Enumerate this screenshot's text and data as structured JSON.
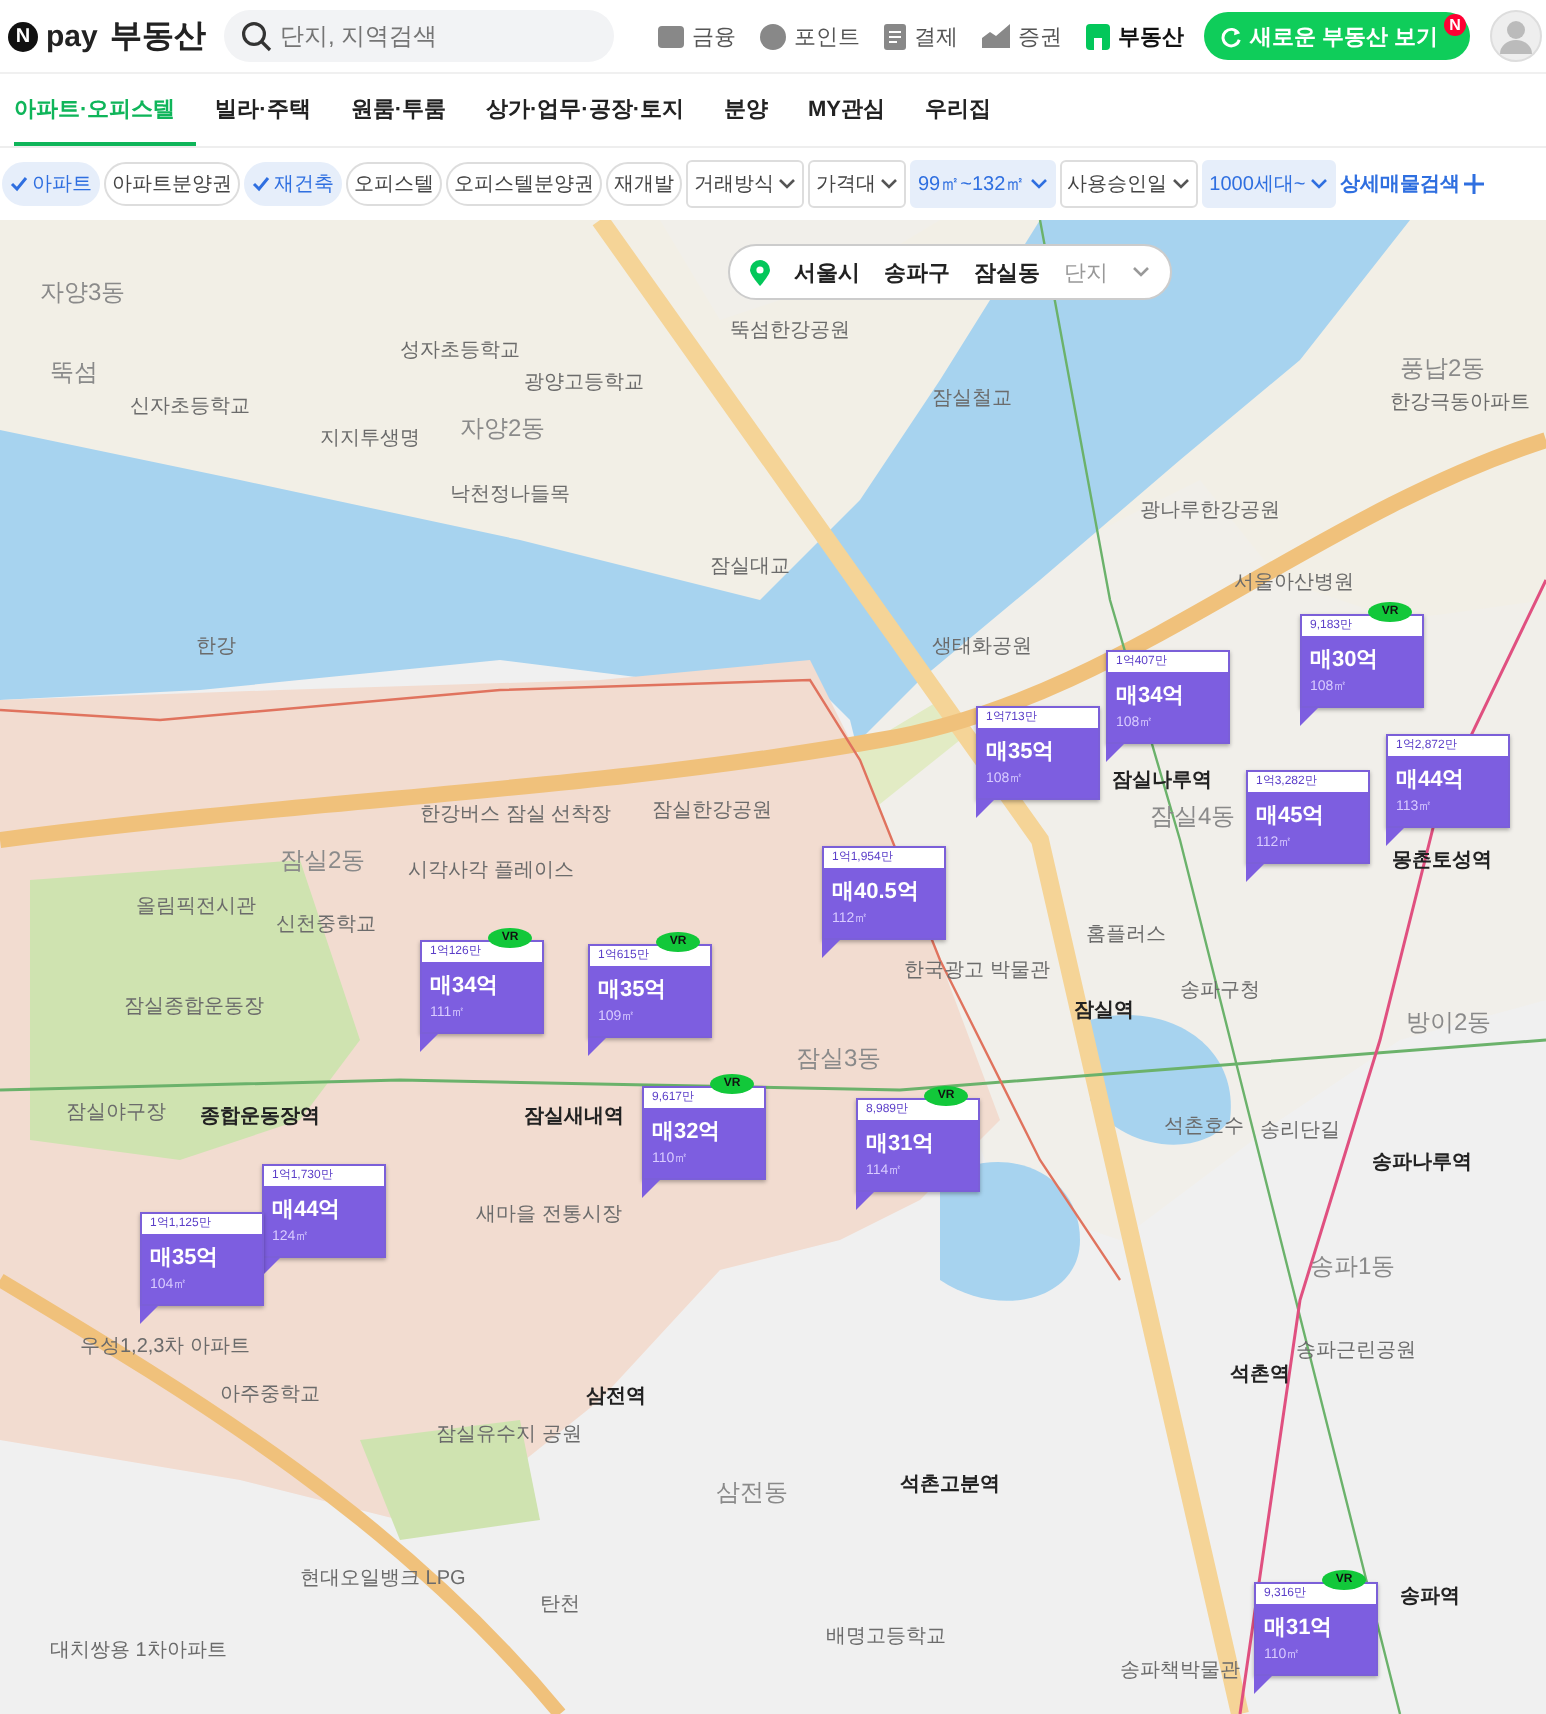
{
  "header": {
    "logo_mark": "N",
    "logo_text": "pay",
    "service": "부동산",
    "search": {
      "placeholder": "단지, 지역검색"
    },
    "nav": [
      {
        "label": "금융",
        "selected": false
      },
      {
        "label": "포인트",
        "selected": false
      },
      {
        "label": "결제",
        "selected": false
      },
      {
        "label": "증권",
        "selected": false
      },
      {
        "label": "부동산",
        "selected": true
      }
    ],
    "cta": {
      "label": "새로운 부동산 보기",
      "badge": "N"
    }
  },
  "tabs": [
    {
      "label": "아파트·오피스텔",
      "selected": true
    },
    {
      "label": "빌라·주택",
      "selected": false
    },
    {
      "label": "원룸·투룸",
      "selected": false
    },
    {
      "label": "상가·업무·공장·토지",
      "selected": false
    },
    {
      "label": "분양",
      "selected": false
    },
    {
      "label": "MY관심",
      "selected": false
    },
    {
      "label": "우리집",
      "selected": false
    }
  ],
  "filters": [
    {
      "kind": "chip",
      "label": "아파트",
      "checked": true
    },
    {
      "kind": "chip",
      "label": "아파트분양권",
      "checked": false
    },
    {
      "kind": "chip",
      "label": "재건축",
      "checked": true
    },
    {
      "kind": "chip",
      "label": "오피스텔",
      "checked": false
    },
    {
      "kind": "chip",
      "label": "오피스텔분양권",
      "checked": false
    },
    {
      "kind": "chip",
      "label": "재개발",
      "checked": false
    },
    {
      "kind": "dropdown",
      "label": "거래방식",
      "checked": false
    },
    {
      "kind": "dropdown",
      "label": "가격대",
      "checked": false
    },
    {
      "kind": "dropdown",
      "label": "99㎡~132㎡",
      "checked": true
    },
    {
      "kind": "dropdown",
      "label": "사용승인일",
      "checked": false
    },
    {
      "kind": "dropdown",
      "label": "1000세대~",
      "checked": true
    },
    {
      "kind": "link",
      "label": "상세매물검색"
    }
  ],
  "breadcrumb": {
    "items": [
      "서울시",
      "송파구",
      "잠실동"
    ],
    "placeholder": "단지"
  },
  "map": {
    "labels": [
      {
        "text": "자양3동",
        "kind": "district"
      },
      {
        "text": "뚝섬",
        "kind": "district"
      },
      {
        "text": "신자초등학교",
        "kind": "place"
      },
      {
        "text": "성자초등학교",
        "kind": "place"
      },
      {
        "text": "지지투생명",
        "kind": "place"
      },
      {
        "text": "자양2동",
        "kind": "district"
      },
      {
        "text": "광양고등학교",
        "kind": "place"
      },
      {
        "text": "뚝섬한강공원",
        "kind": "place"
      },
      {
        "text": "낙천정나들목",
        "kind": "place"
      },
      {
        "text": "잠실철교",
        "kind": "place"
      },
      {
        "text": "한강",
        "kind": "place"
      },
      {
        "text": "잠실대교",
        "kind": "place"
      },
      {
        "text": "광나루한강공원",
        "kind": "place"
      },
      {
        "text": "서울아산병원",
        "kind": "place"
      },
      {
        "text": "풍납2동",
        "kind": "district"
      },
      {
        "text": "한강극동아파트",
        "kind": "place"
      },
      {
        "text": "생태화공원",
        "kind": "place"
      },
      {
        "text": "한강버스 잠실 선착장",
        "kind": "place"
      },
      {
        "text": "잠실한강공원",
        "kind": "place"
      },
      {
        "text": "잠실2동",
        "kind": "district"
      },
      {
        "text": "시각사각 플레이스",
        "kind": "place"
      },
      {
        "text": "올림픽전시관",
        "kind": "place"
      },
      {
        "text": "신천중학교",
        "kind": "place"
      },
      {
        "text": "잠실종합운동장",
        "kind": "place"
      },
      {
        "text": "잠실야구장",
        "kind": "place"
      },
      {
        "text": "종합운동장역",
        "kind": "station"
      },
      {
        "text": "잠실새내역",
        "kind": "station"
      },
      {
        "text": "새마을 전통시장",
        "kind": "place"
      },
      {
        "text": "잠실3동",
        "kind": "district"
      },
      {
        "text": "한국광고 박물관",
        "kind": "place"
      },
      {
        "text": "홈플러스",
        "kind": "place"
      },
      {
        "text": "잠실역",
        "kind": "station"
      },
      {
        "text": "송파구청",
        "kind": "place"
      },
      {
        "text": "석촌호수",
        "kind": "place"
      },
      {
        "text": "방이2동",
        "kind": "district"
      },
      {
        "text": "송파나루역",
        "kind": "station"
      },
      {
        "text": "송리단길",
        "kind": "place"
      },
      {
        "text": "송파1동",
        "kind": "district"
      },
      {
        "text": "석촌역",
        "kind": "station"
      },
      {
        "text": "삼전역",
        "kind": "station"
      },
      {
        "text": "석촌고분역",
        "kind": "station"
      },
      {
        "text": "삼전동",
        "kind": "district"
      },
      {
        "text": "송파책박물관",
        "kind": "place"
      },
      {
        "text": "송파역",
        "kind": "station"
      },
      {
        "text": "탄천",
        "kind": "place"
      },
      {
        "text": "현대오일뱅크 LPG",
        "kind": "place"
      },
      {
        "text": "대치쌍용 1차아파트",
        "kind": "place"
      },
      {
        "text": "잠실4동",
        "kind": "district"
      },
      {
        "text": "몽촌토성역",
        "kind": "station"
      },
      {
        "text": "잠실나루역",
        "kind": "station"
      },
      {
        "text": "배명고등학교",
        "kind": "place"
      },
      {
        "text": "잠실유수지 공원",
        "kind": "place"
      },
      {
        "text": "아주중학교",
        "kind": "place"
      },
      {
        "text": "우성1,2,3차 아파트",
        "kind": "place"
      },
      {
        "text": "송파근린공원",
        "kind": "place"
      }
    ],
    "markers": [
      {
        "unit_price": "1억407만",
        "price": "매34억",
        "area": "108㎡"
      },
      {
        "unit_price": "9,183만",
        "price": "매30억",
        "area": "108㎡",
        "badge": "VR"
      },
      {
        "unit_price": "1억713만",
        "price": "매35억",
        "area": "108㎡"
      },
      {
        "unit_price": "1억3,282만",
        "price": "매45억",
        "area": "112㎡"
      },
      {
        "unit_price": "1억2,872만",
        "price": "매44억",
        "area": "113㎡"
      },
      {
        "unit_price": "1억1,954만",
        "price": "매40.5억",
        "area": "112㎡"
      },
      {
        "unit_price": "1억126만",
        "price": "매34억",
        "area": "111㎡",
        "badge": "VR"
      },
      {
        "unit_price": "1억615만",
        "price": "매35억",
        "area": "109㎡",
        "badge": "VR"
      },
      {
        "unit_price": "9,617만",
        "price": "매32억",
        "area": "110㎡",
        "badge": "VR"
      },
      {
        "unit_price": "8,989만",
        "price": "매31억",
        "area": "114㎡",
        "badge": "VR"
      },
      {
        "unit_price": "1억1,730만",
        "price": "매44억",
        "area": "124㎡"
      },
      {
        "unit_price": "1억1,125만",
        "price": "매35억",
        "area": "104㎡"
      },
      {
        "unit_price": "9,316만",
        "price": "매31억",
        "area": "110㎡",
        "badge": "VR"
      }
    ]
  }
}
